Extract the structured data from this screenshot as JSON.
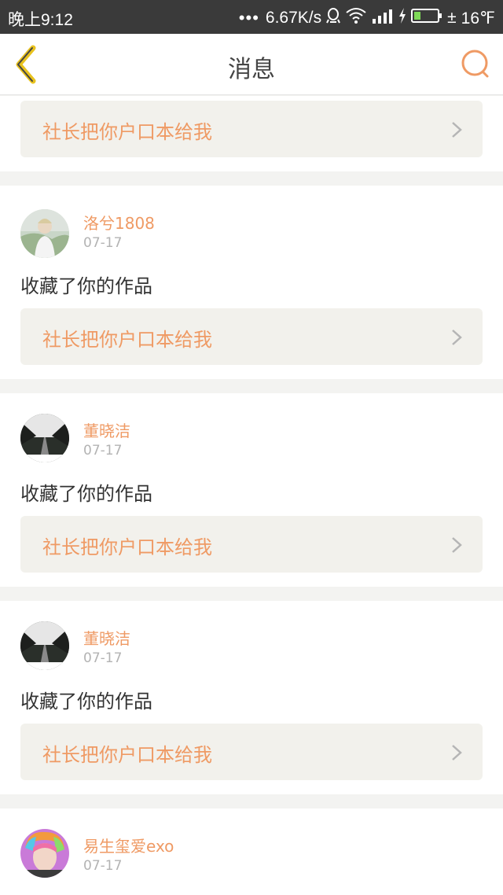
{
  "status_bar": {
    "time": "晚上9:12",
    "dots": "•••",
    "speed": "6.67K/s",
    "battery_label": "±",
    "temperature": "16℉"
  },
  "nav": {
    "title": "消息",
    "back_icon": "chevron-left-icon",
    "search_icon": "search-icon"
  },
  "colors": {
    "accent": "#ef9a64",
    "back_icon": "#e8c21e",
    "card_bg": "#f2f1ec",
    "status_bar_bg": "#3a3a3a"
  },
  "messages": [
    {
      "card": "社长把你户口本给我"
    },
    {
      "user": "洛兮1808",
      "date": "07-17",
      "action": "收藏了你的作品",
      "card": "社长把你户口本给我"
    },
    {
      "user": "董晓洁",
      "date": "07-17",
      "action": "收藏了你的作品",
      "card": "社长把你户口本给我"
    },
    {
      "user": "董晓洁",
      "date": "07-17",
      "action": "收藏了你的作品",
      "card": "社长把你户口本给我"
    },
    {
      "user": "易生玺爱exo",
      "date": "07-17"
    }
  ]
}
